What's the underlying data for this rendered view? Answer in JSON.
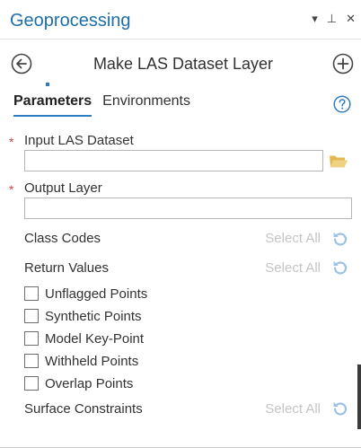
{
  "pane": {
    "title": "Geoprocessing",
    "controls": {
      "menu": "▾",
      "pin": "⊥",
      "close": "✕"
    }
  },
  "tool": {
    "title": "Make LAS Dataset Layer"
  },
  "tabs": [
    {
      "label": "Parameters",
      "active": true
    },
    {
      "label": "Environments",
      "active": false
    }
  ],
  "params": {
    "required_mark": "*",
    "input_las": {
      "label": "Input LAS Dataset",
      "value": "",
      "placeholder": ""
    },
    "output_layer": {
      "label": "Output Layer",
      "value": "",
      "placeholder": ""
    },
    "class_codes": {
      "label": "Class Codes",
      "select_all": "Select All"
    },
    "return_values": {
      "label": "Return Values",
      "select_all": "Select All"
    },
    "flags": [
      {
        "label": "Unflagged Points",
        "checked": false
      },
      {
        "label": "Synthetic Points",
        "checked": false
      },
      {
        "label": "Model Key-Point",
        "checked": false
      },
      {
        "label": "Withheld Points",
        "checked": false
      },
      {
        "label": "Overlap Points",
        "checked": false
      }
    ],
    "surface_constraints": {
      "label": "Surface Constraints",
      "select_all": "Select All"
    }
  },
  "colors": {
    "accent": "#2f7bc4",
    "title": "#1d6ea8",
    "required": "#c84a3c",
    "disabled": "#c4c4c4",
    "folder": "#e9c86a",
    "help": "#2f7bc4",
    "reset": "#9dc1e3"
  },
  "icons": {
    "back": "back-arrow-circle-icon",
    "add": "add-circle-icon",
    "help": "help-circle-icon",
    "folder": "folder-open-icon",
    "reset": "reset-undo-icon"
  }
}
